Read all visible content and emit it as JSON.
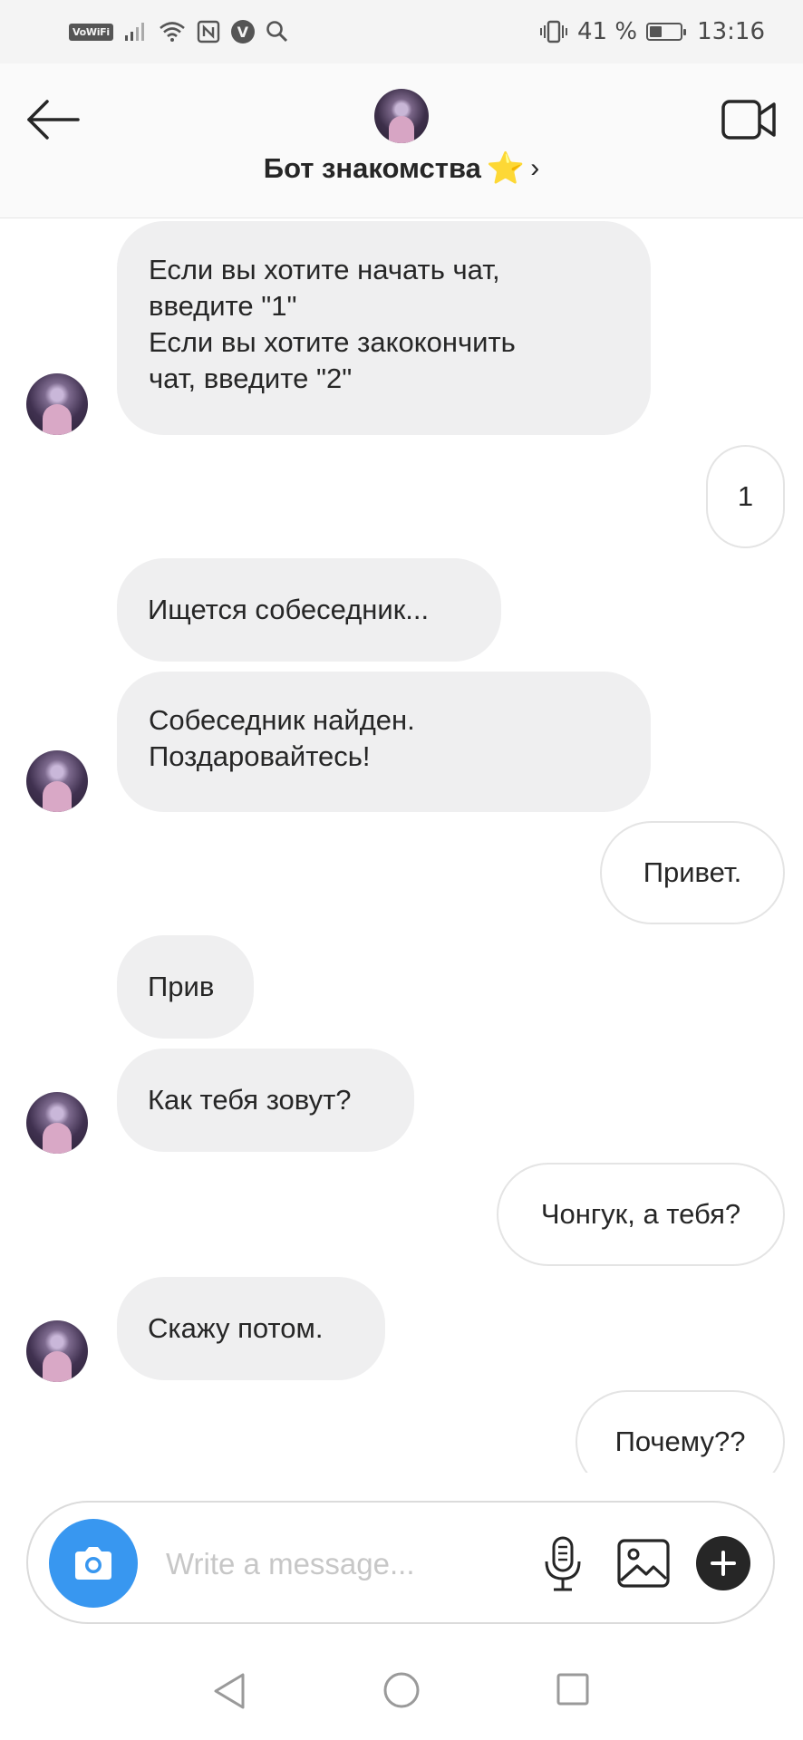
{
  "status_bar": {
    "vowifi": "VoWiFi",
    "badge_letter": "V",
    "battery_percent": "41 %",
    "battery_level": 0.41,
    "time": "13:16"
  },
  "header": {
    "title": "Бот знакомства",
    "star": "⭐",
    "chevron": "›"
  },
  "messages": [
    {
      "side": "in",
      "lines": [
        "Если вы хотите  начать чат,",
        "введите \"1\"",
        "Если вы хотите закокончить",
        "чат, введите \"2\""
      ]
    },
    {
      "side": "out",
      "lines": [
        "1"
      ]
    },
    {
      "side": "in",
      "lines": [
        "Ищется собеседник..."
      ]
    },
    {
      "side": "in",
      "lines": [
        "Собеседник найден.",
        "Поздаровайтесь!"
      ]
    },
    {
      "side": "out",
      "lines": [
        "Привет."
      ]
    },
    {
      "side": "in",
      "lines": [
        "Прив"
      ]
    },
    {
      "side": "in",
      "lines": [
        "Как тебя зовут?"
      ]
    },
    {
      "side": "out",
      "lines": [
        "Чонгук, а тебя?"
      ]
    },
    {
      "side": "in",
      "lines": [
        "Скажу потом."
      ]
    },
    {
      "side": "out",
      "lines": [
        "Почему??"
      ]
    }
  ],
  "composer": {
    "placeholder": "Write a message...",
    "value": ""
  },
  "icons": {
    "back": "arrow-left-icon",
    "video": "video-camera-icon",
    "camera": "camera-icon",
    "mic": "microphone-icon",
    "gallery": "image-icon",
    "plus": "plus-icon",
    "nav_back": "triangle-back-icon",
    "nav_home": "circle-home-icon",
    "nav_recent": "square-recent-icon"
  },
  "colors": {
    "accent": "#3897f0",
    "incoming_bubble": "#efeff0",
    "outgoing_border": "#e4e4e4",
    "text": "#262626",
    "star": "#f5c21a"
  }
}
